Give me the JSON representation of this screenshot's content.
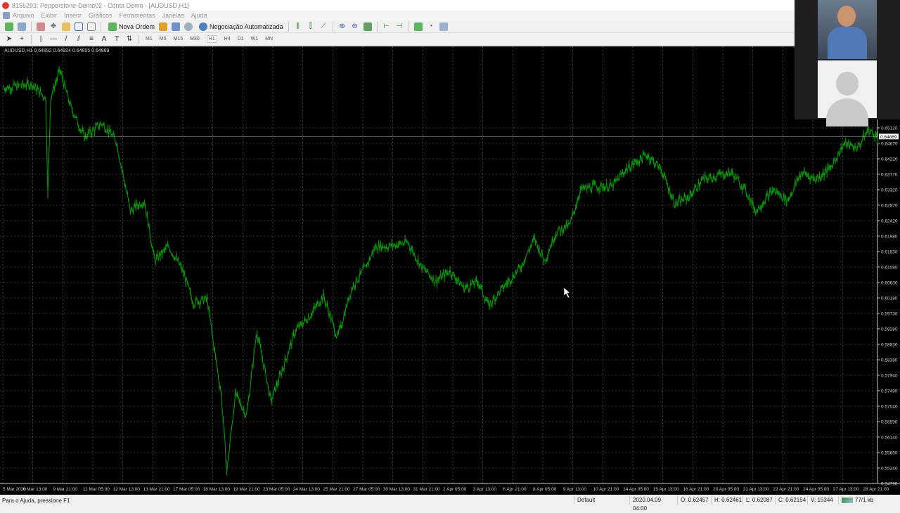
{
  "window": {
    "title": "8156293: Pepperstone-Demo02 - Conta Demo - [AUDUSD,H1]"
  },
  "menu": [
    "Arquivo",
    "Exibir",
    "Inserir",
    "Gráficos",
    "Ferramentas",
    "Janelas",
    "Ajuda"
  ],
  "toolbar": {
    "new_order": "Nova Ordem",
    "auto_trading": "Negociação Automatizada"
  },
  "timeframes": [
    "M1",
    "M5",
    "M15",
    "M30",
    "H1",
    "H4",
    "D1",
    "W1",
    "MN"
  ],
  "active_timeframe": "H1",
  "chart_data": {
    "type": "line",
    "title": "AUDUSD,H1  0.64892 0.64924 0.64855 0.64869",
    "symbol": "AUDUSD",
    "timeframe": "H1",
    "current_price": "0.64869",
    "ylim": [
      0.5479,
      0.6512
    ],
    "y_ticks": [
      "0.65120",
      "0.64670",
      "0.64220",
      "0.63770",
      "0.63320",
      "0.62870",
      "0.62420",
      "0.61980",
      "0.61530",
      "0.61080",
      "0.60630",
      "0.60180",
      "0.59730",
      "0.59280",
      "0.58830",
      "0.58380",
      "0.57940",
      "0.57490",
      "0.57040",
      "0.56590",
      "0.56140",
      "0.55690",
      "0.55240",
      "0.54790"
    ],
    "x_ticks": [
      "5 Mar 2020",
      "6 Mar 13:00",
      "9 Mar 21:00",
      "11 Mar 05:00",
      "12 Mar 13:00",
      "13 Mar 21:00",
      "17 Mar 05:00",
      "18 Mar 13:00",
      "19 Mar 21:00",
      "23 Mar 05:00",
      "24 Mar 13:00",
      "25 Mar 21:00",
      "27 Mar 05:00",
      "30 Mar 13:00",
      "31 Mar 21:00",
      "2 Apr 05:00",
      "3 Apr 13:00",
      "6 Apr 21:00",
      "8 Apr 05:00",
      "9 Apr 13:00",
      "10 Apr 21:00",
      "14 Apr 05:00",
      "15 Apr 13:00",
      "16 Apr 21:00",
      "20 Apr 05:00",
      "21 Apr 13:00",
      "22 Apr 21:00",
      "24 Apr 05:00",
      "27 Apr 13:00",
      "28 Apr 21:00"
    ],
    "bars_per_tick": 32,
    "series": [
      {
        "name": "AUDUSD",
        "color": "#00a000",
        "points": [
          [
            4,
            0.6629
          ],
          [
            34,
            0.6639
          ],
          [
            49,
            0.6598
          ],
          [
            51,
            0.6312
          ],
          [
            54,
            0.66
          ],
          [
            64,
            0.668
          ],
          [
            75,
            0.6577
          ],
          [
            90,
            0.6485
          ],
          [
            109,
            0.6526
          ],
          [
            124,
            0.6475
          ],
          [
            139,
            0.6271
          ],
          [
            154,
            0.6301
          ],
          [
            165,
            0.6127
          ],
          [
            180,
            0.6168
          ],
          [
            195,
            0.6097
          ],
          [
            206,
            0.6005
          ],
          [
            221,
            0.6015
          ],
          [
            229,
            0.5862
          ],
          [
            236,
            0.5739
          ],
          [
            242,
            0.5514
          ],
          [
            251,
            0.5739
          ],
          [
            263,
            0.5677
          ],
          [
            274,
            0.5923
          ],
          [
            289,
            0.5718
          ],
          [
            300,
            0.58
          ],
          [
            315,
            0.5923
          ],
          [
            330,
            0.5964
          ],
          [
            345,
            0.6025
          ],
          [
            360,
            0.5902
          ],
          [
            375,
            0.6046
          ],
          [
            390,
            0.6107
          ],
          [
            401,
            0.6168
          ],
          [
            413,
            0.6168
          ],
          [
            435,
            0.6179
          ],
          [
            450,
            0.6107
          ],
          [
            465,
            0.6066
          ],
          [
            480,
            0.6097
          ],
          [
            495,
            0.6046
          ],
          [
            510,
            0.6066
          ],
          [
            521,
            0.5995
          ],
          [
            536,
            0.6046
          ],
          [
            555,
            0.6107
          ],
          [
            570,
            0.6189
          ],
          [
            581,
            0.6127
          ],
          [
            593,
            0.6209
          ],
          [
            608,
            0.623
          ],
          [
            619,
            0.6332
          ],
          [
            634,
            0.6342
          ],
          [
            653,
            0.6342
          ],
          [
            668,
            0.6393
          ],
          [
            690,
            0.6434
          ],
          [
            705,
            0.6393
          ],
          [
            720,
            0.6291
          ],
          [
            735,
            0.6312
          ],
          [
            750,
            0.6363
          ],
          [
            780,
            0.6383
          ],
          [
            795,
            0.6332
          ],
          [
            806,
            0.6271
          ],
          [
            825,
            0.6332
          ],
          [
            840,
            0.6301
          ],
          [
            855,
            0.6383
          ],
          [
            870,
            0.6363
          ],
          [
            885,
            0.6393
          ],
          [
            900,
            0.6465
          ],
          [
            915,
            0.6455
          ],
          [
            926,
            0.6506
          ],
          [
            936,
            0.6487
          ]
        ]
      }
    ]
  },
  "status": {
    "help": "Para o Ajuda, pressione F1",
    "profile": "Default",
    "datetime": "2020.04.09 04:00",
    "open": "O: 0.62457",
    "high": "H: 0.62461",
    "low": "L: 0.62087",
    "close": "C: 0.62154",
    "volume": "V: 15344",
    "traffic": "77/1 kb"
  }
}
